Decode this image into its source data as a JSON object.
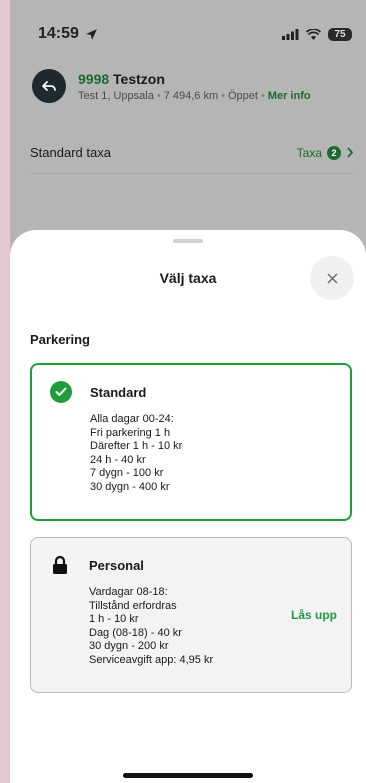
{
  "status": {
    "time": "14:59",
    "battery": "75"
  },
  "zone": {
    "code": "9998",
    "name": "Testzon",
    "location": "Test 1, Uppsala",
    "distance": "7 494,6 km",
    "state": "Öppet",
    "more_info": "Mer info"
  },
  "rate_row": {
    "label": "Standard taxa",
    "link_label": "Taxa",
    "count": "2"
  },
  "sheet": {
    "title": "Välj taxa",
    "section": "Parkering",
    "cards": [
      {
        "name": "Standard",
        "selected": true,
        "icon": "check-circle-icon",
        "lines": [
          "Alla dagar 00-24:",
          "Fri parkering 1 h",
          "Därefter 1 h - 10 kr",
          "24 h - 40 kr",
          "7 dygn - 100 kr",
          "30 dygn - 400 kr"
        ]
      },
      {
        "name": "Personal",
        "selected": false,
        "icon": "lock-icon",
        "unlock_label": "Lås upp",
        "lines": [
          "Vardagar 08-18:",
          "Tillstånd erfordras",
          "1 h - 10 kr",
          "Dag (08-18) - 40 kr",
          "30 dygn - 200 kr",
          "Serviceavgift app: 4,95 kr"
        ]
      }
    ]
  },
  "colors": {
    "accent": "#1f9d3a",
    "dark_accent": "#1e6a2e"
  }
}
